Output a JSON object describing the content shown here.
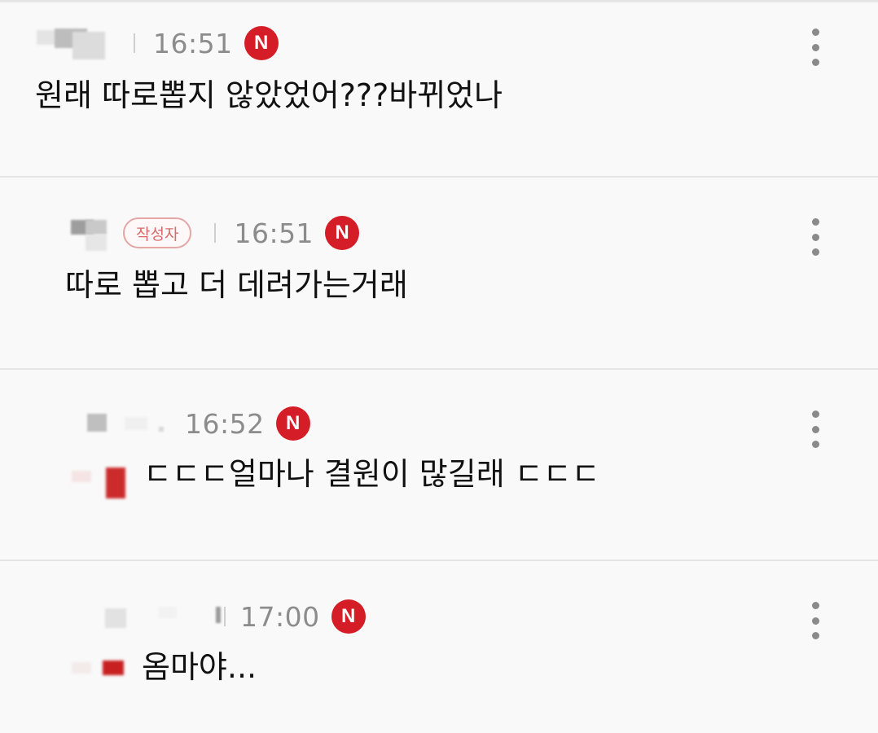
{
  "comments": [
    {
      "time": "16:51",
      "new_badge": "N",
      "text": "원래 따로뽑지 않았었어???바뀌었나"
    },
    {
      "time": "16:51",
      "author_badge": "작성자",
      "new_badge": "N",
      "text": "따로 뽑고 더 데려가는거래"
    },
    {
      "time": "16:52",
      "new_badge": "N",
      "text": "ㄷㄷㄷ얼마나 결원이 많길래 ㄷㄷㄷ"
    },
    {
      "time": "17:00",
      "new_badge": "N",
      "text": "옴마야..."
    }
  ],
  "colors": {
    "new_badge": "#d51d28",
    "author_badge_border": "#e3a7a7",
    "author_badge_text": "#d86a6a",
    "time": "#8c8c8c",
    "text": "#111111",
    "divider": "#e5e5e5"
  },
  "icons": {
    "more": "more-vertical-icon"
  }
}
